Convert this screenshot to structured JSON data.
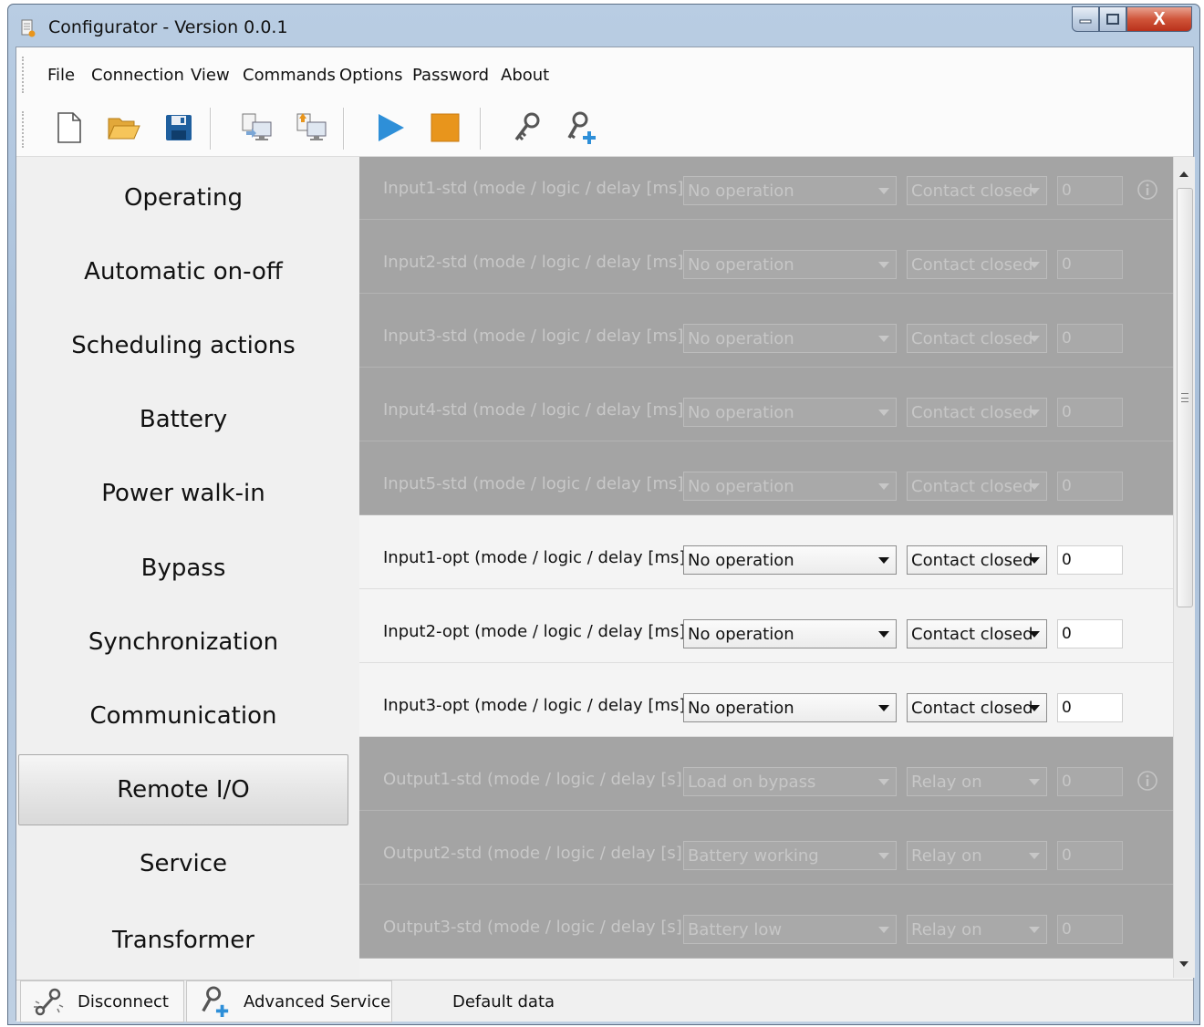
{
  "window": {
    "title": "Configurator - Version 0.0.1",
    "close_glyph": "X"
  },
  "menu": {
    "items": [
      "File",
      "Connection",
      "View",
      "Commands",
      "Options",
      "Password",
      "About"
    ]
  },
  "toolbar": {
    "icons": [
      "new-file-icon",
      "open-folder-icon",
      "save-icon",
      "read-from-device-icon",
      "write-to-device-icon",
      "play-icon",
      "stop-icon",
      "key-icon",
      "add-user-icon"
    ]
  },
  "nav": {
    "items": [
      "Operating",
      "Automatic on-off",
      "Scheduling actions",
      "Battery",
      "Power walk-in",
      "Bypass",
      "Synchronization",
      "Communication",
      "Remote I/O",
      "Service",
      "Transformer"
    ],
    "active_index": 8
  },
  "rows": [
    {
      "label": "Input1-std (mode / logic / delay [ms])",
      "mode": "No operation",
      "logic": "Contact closed",
      "delay": "0",
      "enabled": false,
      "info": true
    },
    {
      "label": "Input2-std (mode / logic / delay [ms])",
      "mode": "No operation",
      "logic": "Contact closed",
      "delay": "0",
      "enabled": false,
      "info": false
    },
    {
      "label": "Input3-std (mode / logic / delay [ms])",
      "mode": "No operation",
      "logic": "Contact closed",
      "delay": "0",
      "enabled": false,
      "info": false
    },
    {
      "label": "Input4-std (mode / logic / delay [ms])",
      "mode": "No operation",
      "logic": "Contact closed",
      "delay": "0",
      "enabled": false,
      "info": false
    },
    {
      "label": "Input5-std (mode / logic / delay [ms])",
      "mode": "No operation",
      "logic": "Contact closed",
      "delay": "0",
      "enabled": false,
      "info": false
    },
    {
      "label": "Input1-opt (mode / logic / delay [ms])",
      "mode": "No operation",
      "logic": "Contact closed",
      "delay": "0",
      "enabled": true,
      "info": false
    },
    {
      "label": "Input2-opt (mode / logic / delay [ms])",
      "mode": "No operation",
      "logic": "Contact closed",
      "delay": "0",
      "enabled": true,
      "info": false
    },
    {
      "label": "Input3-opt (mode / logic / delay [ms])",
      "mode": "No operation",
      "logic": "Contact closed",
      "delay": "0",
      "enabled": true,
      "info": false
    },
    {
      "label": "Output1-std (mode / logic / delay [s])",
      "mode": "Load on bypass",
      "logic": "Relay on",
      "delay": "0",
      "enabled": false,
      "info": true
    },
    {
      "label": "Output2-std (mode / logic / delay [s])",
      "mode": "Battery working",
      "logic": "Relay on",
      "delay": "0",
      "enabled": false,
      "info": false
    },
    {
      "label": "Output3-std (mode / logic / delay [s])",
      "mode": "Battery low",
      "logic": "Relay on",
      "delay": "0",
      "enabled": false,
      "info": false
    }
  ],
  "status": {
    "disconnect": "Disconnect",
    "advanced_service": "Advanced Service",
    "default_data": "Default data"
  },
  "colors": {
    "accent_blue": "#2e8fd8",
    "stop_orange": "#e8951c",
    "disabled_row": "#a4a4a4"
  }
}
